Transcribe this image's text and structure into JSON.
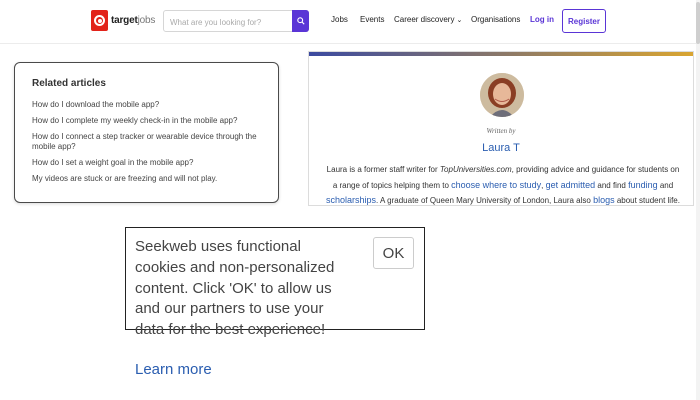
{
  "header": {
    "logo": {
      "brand": "target",
      "suffix": "jobs"
    },
    "search": {
      "placeholder": "What are you looking for?"
    },
    "nav": [
      {
        "label": "Jobs"
      },
      {
        "label": "Events"
      },
      {
        "label": "Career discovery"
      },
      {
        "label": "Organisations"
      }
    ],
    "login_label": "Log in",
    "register_label": "Register"
  },
  "related": {
    "title": "Related articles",
    "items": [
      "How do I download the mobile app?",
      "How do I complete my weekly check-in in the mobile app?",
      "How do I connect a step tracker or wearable device through the mobile app?",
      "How do I set a weight goal in the mobile app?",
      "My videos are stuck or are freezing and will not play."
    ]
  },
  "author": {
    "written_by": "Written by",
    "name": "Laura T",
    "bio": {
      "t1": "Laura is a former staff writer for ",
      "site": "TopUniversities.com",
      "t2": ", providing advice and guidance for students on a range of topics helping them to ",
      "link1": "choose where to study",
      "t3": ", ",
      "link2": "get admitted",
      "t4": " and find ",
      "link3": "funding",
      "t5": " and ",
      "link4": "scholarships",
      "t6": ". A graduate of Queen Mary University of London, Laura also ",
      "link5": "blogs",
      "t7": " about student life."
    }
  },
  "cookie": {
    "text": "Seekweb uses functional cookies and non-personalized content. Click 'OK' to allow us and our partners to use your data for the best experience!",
    "learn_more": "Learn more",
    "ok_label": "OK"
  },
  "colors": {
    "brand_red": "#e2231a",
    "accent_purple": "#5a35d6",
    "link_blue": "#2a5db0"
  }
}
